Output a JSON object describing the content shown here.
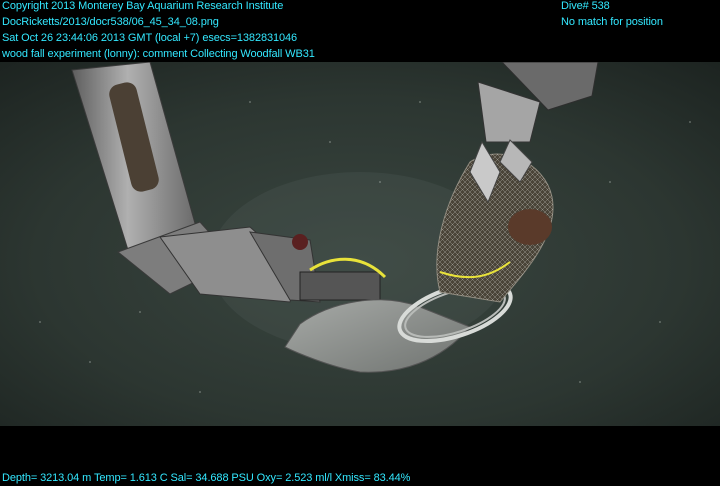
{
  "overlay": {
    "header_lines": [
      "Copyright 2013 Monterey Bay Aquarium Research Institute",
      "DocRicketts/2013/docr538/06_45_34_08.png",
      "Sat Oct 26 23:44:06 2013 GMT (local +7)  esecs=1382831046",
      "wood fall experiment (lonny): comment Collecting Woodfall WB31"
    ],
    "dive": "Dive# 538",
    "position_status": "No match for position",
    "telemetry": "Depth= 3213.04 m  Temp= 1.613 C  Sal= 34.688 PSU  Oxy= 2.523 ml/l  Xmiss= 83.44%"
  },
  "scene": {
    "subjects": [
      "manipulator-arm",
      "sampling-net",
      "mesh-bag",
      "wood-sample",
      "gripper-claw"
    ],
    "colors": {
      "background": "#000000",
      "water": "#2f3a35",
      "arm_metal": "#8a8a8a",
      "net_bag": "#9a9c9a",
      "cable": "#e8e23a",
      "text": "#33e8ff"
    }
  }
}
